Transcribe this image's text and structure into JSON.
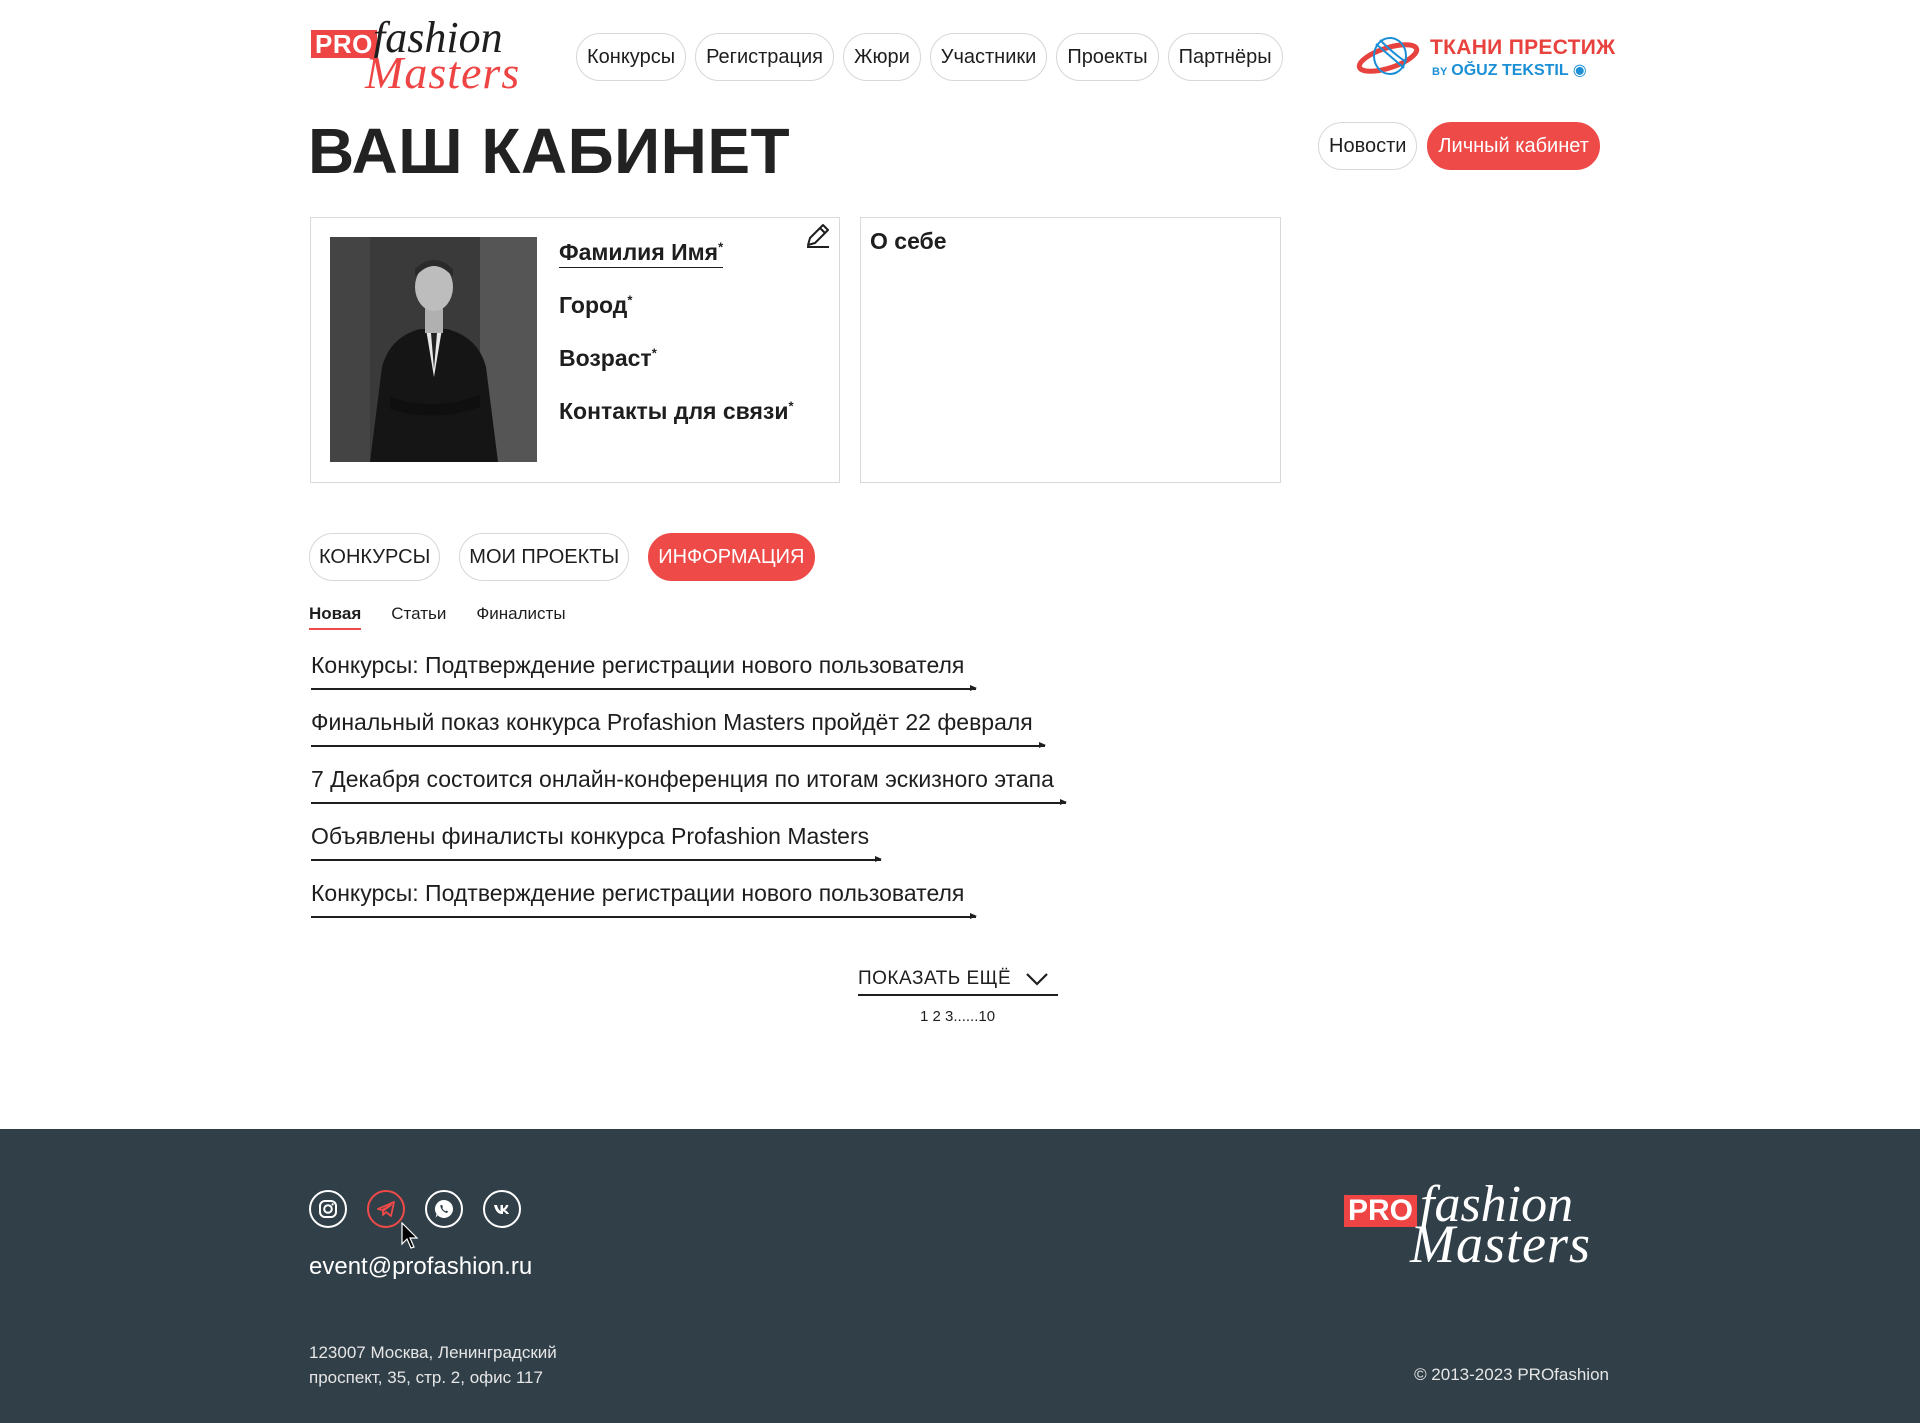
{
  "header": {
    "logo": {
      "pro": "PRO",
      "fashion": "fashion",
      "masters": "Masters"
    },
    "nav": [
      "Конкурсы",
      "Регистрация",
      "Жюри",
      "Участники",
      "Проекты",
      "Партнёры"
    ],
    "sponsor": {
      "line1": "ТКАНИ ПРЕСТИЖ",
      "by": "BY",
      "line2": "OĞUZ TEKSTIL"
    }
  },
  "page": {
    "title": "ВАШ КАБИНЕТ",
    "top_buttons": {
      "news": "Новости",
      "cabinet": "Личный кабинет"
    }
  },
  "profile": {
    "fields": [
      {
        "label": "Фамилия Имя"
      },
      {
        "label": "Город"
      },
      {
        "label": "Возраст"
      },
      {
        "label": "Контакты для связи"
      }
    ],
    "required_mark": "*",
    "about_title": "О себе"
  },
  "tabs": [
    "КОНКУРСЫ",
    "МОИ ПРОЕКТЫ",
    "ИНФОРМАЦИЯ"
  ],
  "subtabs": [
    "Новая",
    "Статьи",
    "Финалисты"
  ],
  "news": [
    "Конкурсы: Подтверждение регистрации нового пользователя",
    "Финальный показ конкурса Profashion Masters пройдёт 22 февраля",
    "7 Декабря состоится онлайн-конференция по итогам эскизного этапа",
    "Объявлены финалисты конкурса Profashion Masters",
    "Конкурсы: Подтверждение регистрации нового пользователя"
  ],
  "more": {
    "label": "ПОКАЗАТЬ ЕЩЁ",
    "pages": "1 2 3......10"
  },
  "footer": {
    "email": "event@profashion.ru",
    "address_line1": "123007 Москва, Ленинградский",
    "address_line2": "проспект, 35, стр. 2, офис 117",
    "copyright": "© 2013-2023 PROfashion",
    "logo": {
      "pro": "PRO",
      "fashion": "fashion",
      "masters": "Masters"
    }
  },
  "colors": {
    "accent": "#ee4a48",
    "footer_bg": "#303f48",
    "sponsor_blue": "#1a8fd6"
  }
}
